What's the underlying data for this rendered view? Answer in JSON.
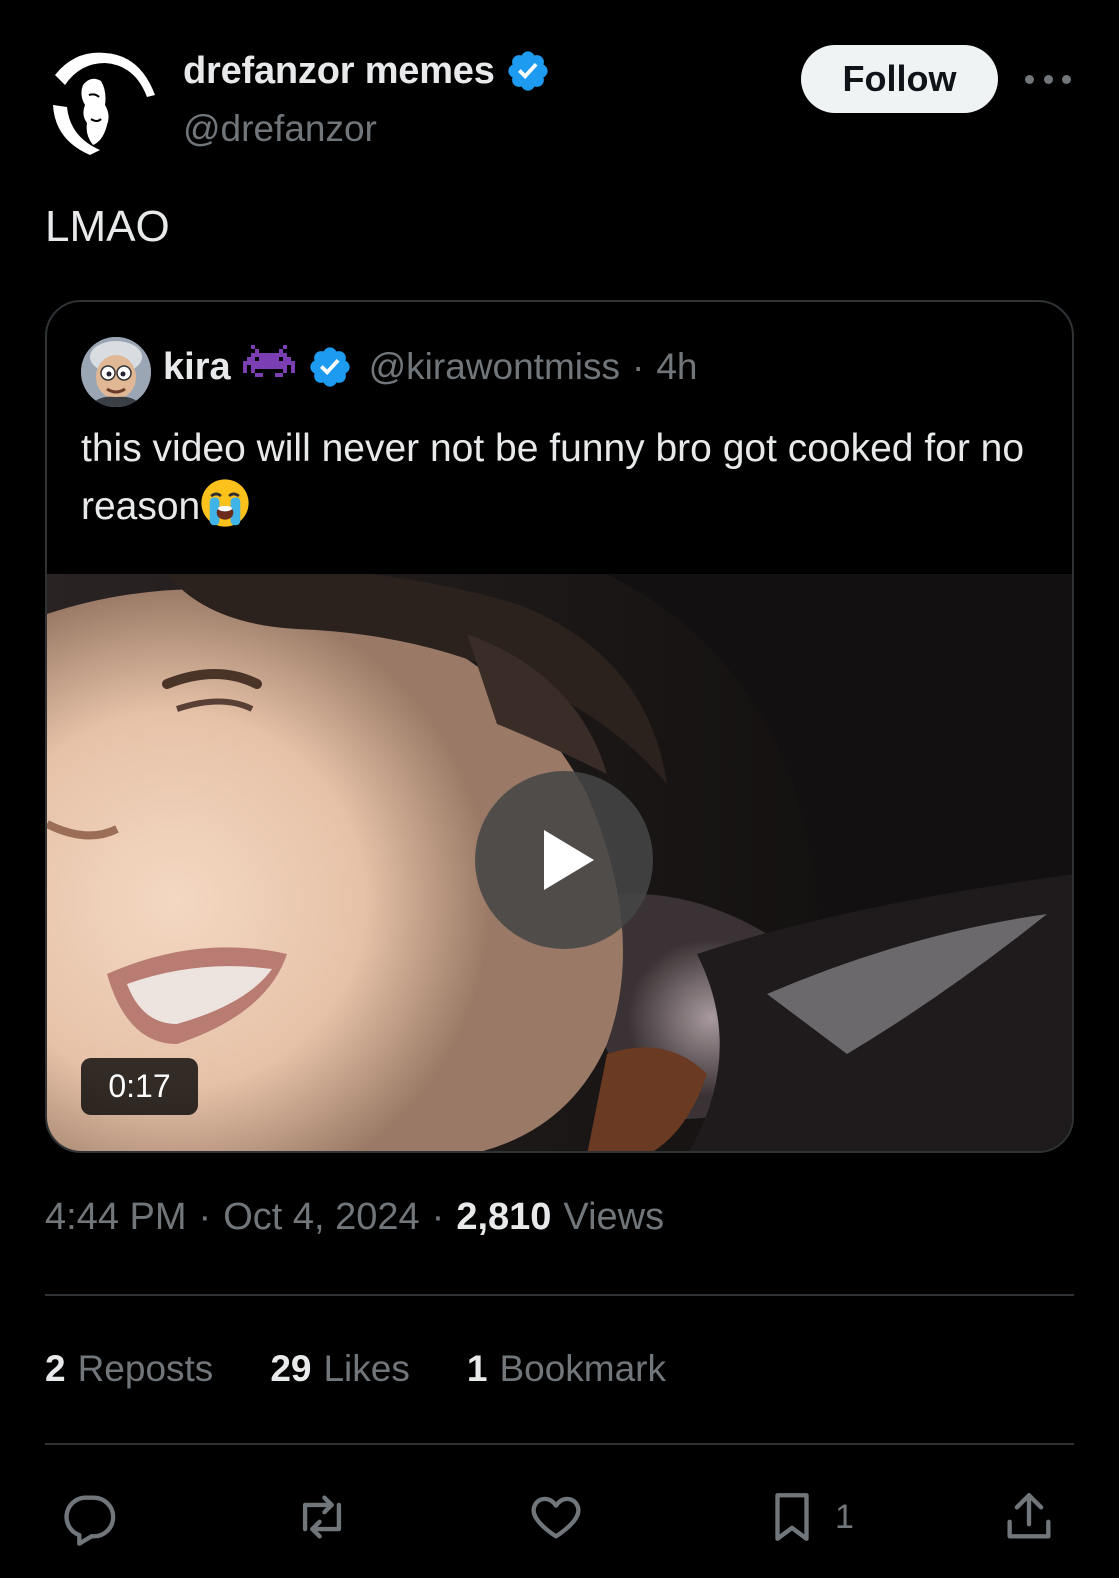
{
  "author": {
    "display_name": "drefanzor memes",
    "handle": "@drefanzor",
    "verified_color": "#1d9bf0"
  },
  "follow_button": {
    "label": "Follow"
  },
  "tweet": {
    "text": "LMAO"
  },
  "quoted_tweet": {
    "display_name": "kira",
    "name_emoji_icon": "alien-monster-icon",
    "handle": "@kirawontmiss",
    "separator": "·",
    "time": "4h",
    "text": "this video will never not be funny bro got cooked for no reason",
    "text_emoji_icon": "loudly-crying-face-icon",
    "video": {
      "duration": "0:17",
      "play_icon": "play-icon"
    }
  },
  "meta": {
    "time": "4:44 PM",
    "separator": "·",
    "date": "Oct 4, 2024",
    "views_count": "2,810",
    "views_label": "Views"
  },
  "stats": [
    {
      "count": "2",
      "label": "Reposts"
    },
    {
      "count": "29",
      "label": "Likes"
    },
    {
      "count": "1",
      "label": "Bookmark"
    }
  ],
  "actions": {
    "reply_icon": "reply-icon",
    "repost_icon": "repost-icon",
    "like_icon": "heart-icon",
    "bookmark_icon": "bookmark-icon",
    "bookmark_count": "1",
    "share_icon": "share-icon"
  }
}
